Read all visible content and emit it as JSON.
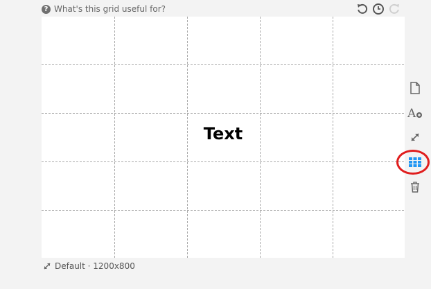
{
  "help": {
    "label": "What's this grid useful for?",
    "icon": "question-circle-icon"
  },
  "top_toolbar": {
    "icons": [
      "undo-icon",
      "history-clock-icon",
      "redo-icon"
    ]
  },
  "canvas": {
    "text": "Text",
    "grid": {
      "columns": 5,
      "rows": 5,
      "visible": true
    }
  },
  "sidebar": {
    "icons": [
      "new-page-icon",
      "add-text-icon",
      "resize-icon",
      "grid-icon",
      "trash-icon"
    ],
    "active": "grid-icon",
    "accent_color": "#2196f3",
    "highlight_color": "#e01e1e"
  },
  "footer": {
    "icon": "resize-icon",
    "label": "Default · 1200x800"
  }
}
